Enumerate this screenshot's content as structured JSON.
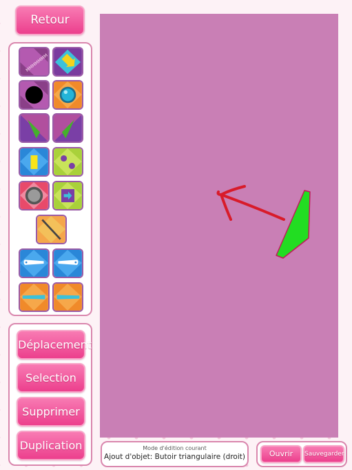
{
  "header": {
    "back_label": "Retour"
  },
  "tools": [
    {
      "name": "spring-tool",
      "label": "MMMMMMM"
    },
    {
      "name": "diamond-arrow-tool"
    },
    {
      "name": "black-hole-tool"
    },
    {
      "name": "blue-ball-tool"
    },
    {
      "name": "left-flipper-tool"
    },
    {
      "name": "right-flipper-tool"
    },
    {
      "name": "yellow-block-tool"
    },
    {
      "name": "bumpers-tool"
    },
    {
      "name": "round-bumper-tool"
    },
    {
      "name": "arrow-block-tool"
    },
    {
      "name": "wall-line-tool"
    },
    {
      "name": "paddle-left-tool"
    },
    {
      "name": "paddle-right-tool"
    },
    {
      "name": "blue-portal-left-tool"
    },
    {
      "name": "blue-portal-right-tool"
    }
  ],
  "modes": {
    "move_label": "Déplacement",
    "select_label": "Selection",
    "delete_label": "Supprimer",
    "duplicate_label": "Duplication"
  },
  "status": {
    "label": "Mode d'édition courant",
    "value": "Ajout d'objet: Butoir triangulaire (droit)"
  },
  "file": {
    "open_label": "Ouvrir",
    "save_label": "Sauvegarder"
  },
  "colors": {
    "canvas": "#c97fb5",
    "accent": "#ec3f8d",
    "bumper": "#22dd22",
    "annotation_arrow": "#d81b2a"
  }
}
